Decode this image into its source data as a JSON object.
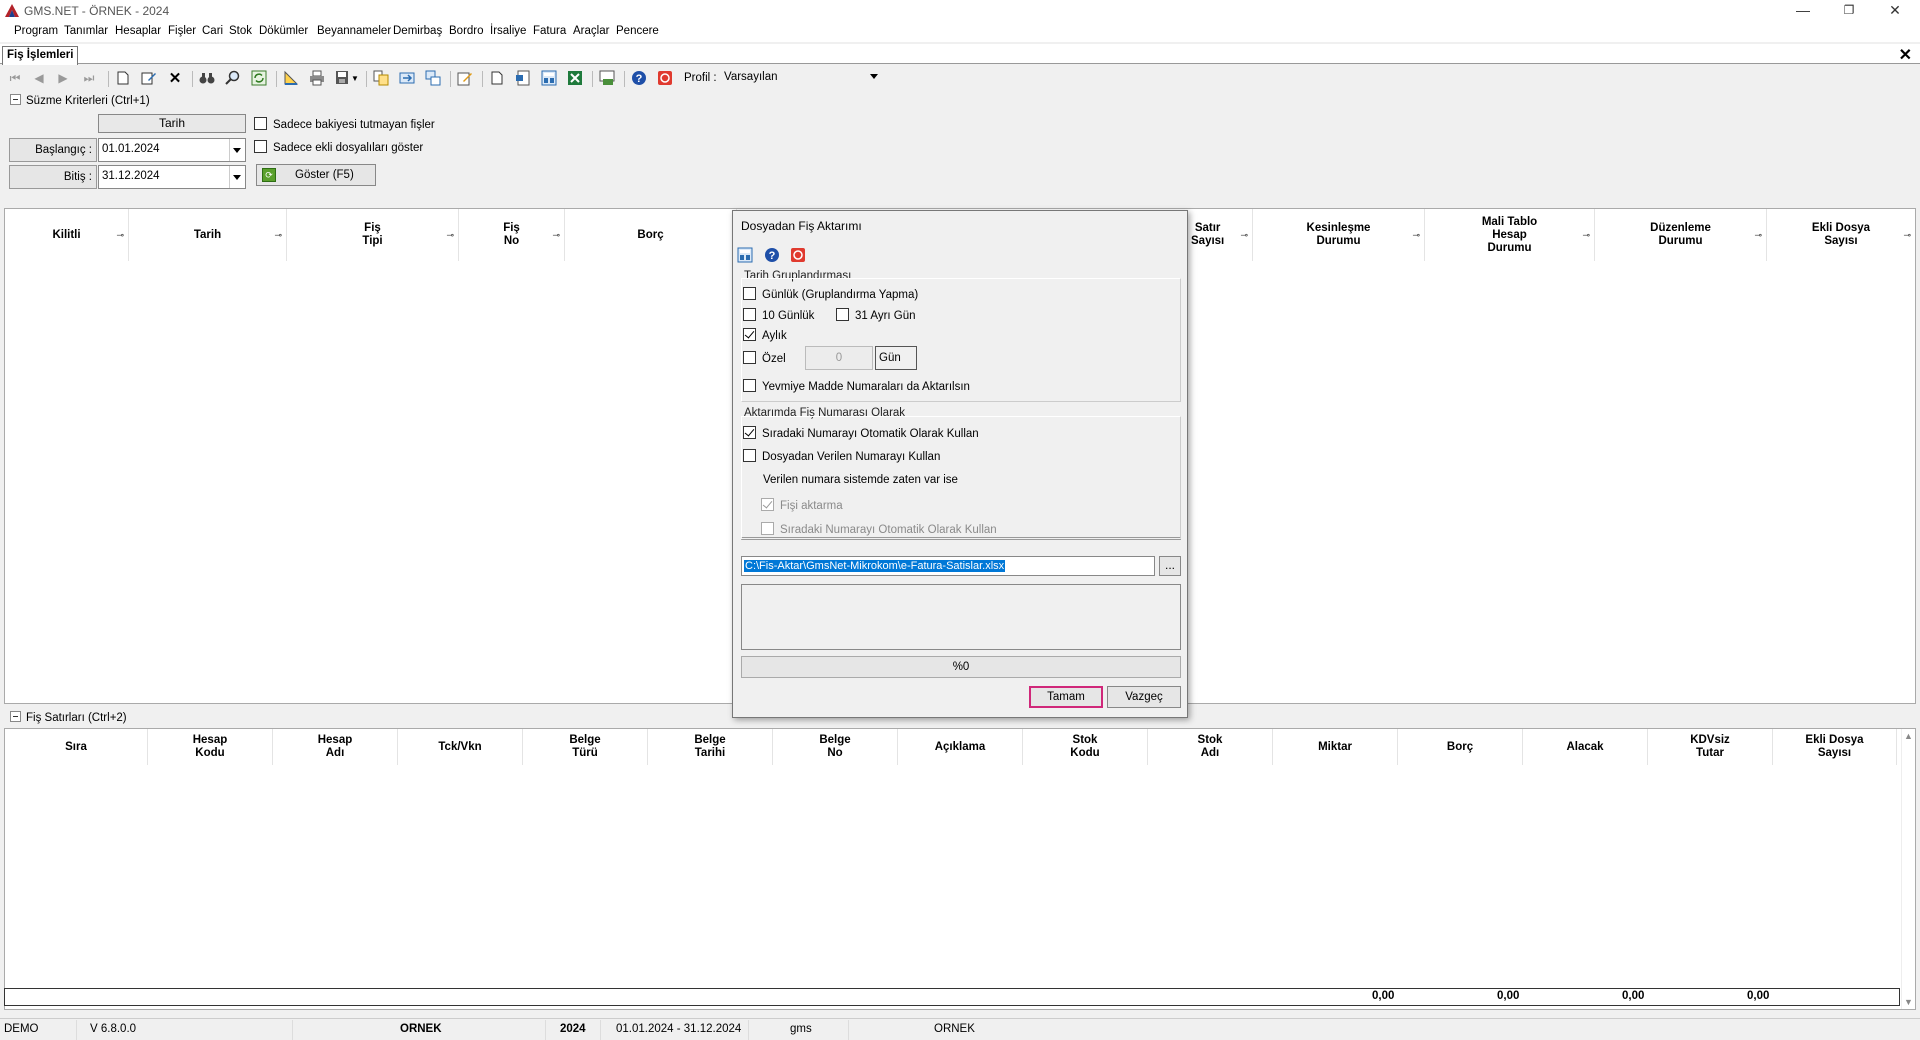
{
  "window": {
    "title": "GMS.NET - ÖRNEK - 2024",
    "minimize": "—",
    "restore": "❐",
    "close": "✕"
  },
  "menu": [
    "Program",
    "Tanımlar",
    "Hesaplar",
    "Fişler",
    "Cari",
    "Stok",
    "Dökümler",
    "Beyannameler",
    "Demirbaş",
    "Bordro",
    "İrsaliye",
    "Fatura",
    "Araçlar",
    "Pencere"
  ],
  "doc_tab": {
    "label": "Fiş İşlemleri",
    "close": "✕"
  },
  "toolbar": {
    "profile_label": "Profil :",
    "profile_value": "Varsayılan"
  },
  "filters": {
    "section_title": "Süzme Kriterleri (Ctrl+1)",
    "tarih_button": "Tarih",
    "start_label": "Başlangıç :",
    "start_value": "01.01.2024",
    "end_label": "Bitiş :",
    "end_value": "31.12.2024",
    "check_unbalanced": "Sadece bakiyesi tutmayan fişler",
    "check_attached": "Sadece ekli dosyalıları göster",
    "show_button": "Göster (F5)"
  },
  "top_grid": {
    "columns": [
      [
        "Kilitli"
      ],
      [
        "Tarih"
      ],
      [
        "Fiş",
        "Tipi"
      ],
      [
        "Fiş",
        "No"
      ],
      [
        "Borç"
      ],
      [
        "Satır",
        "Sayısı"
      ],
      [
        "Kesinleşme",
        "Durumu"
      ],
      [
        "Mali Tablo",
        "Hesap",
        "Durumu"
      ],
      [
        "Düzenleme",
        "Durumu"
      ],
      [
        "Ekli Dosya",
        "Sayısı"
      ]
    ]
  },
  "lines": {
    "section_title": "Fiş Satırları (Ctrl+2)",
    "columns": [
      [
        "Sıra"
      ],
      [
        "Hesap",
        "Kodu"
      ],
      [
        "Hesap",
        "Adı"
      ],
      [
        "Tck/Vkn"
      ],
      [
        "Belge",
        "Türü"
      ],
      [
        "Belge",
        "Tarihi"
      ],
      [
        "Belge",
        "No"
      ],
      [
        "Açıklama"
      ],
      [
        "Stok",
        "Kodu"
      ],
      [
        "Stok",
        "Adı"
      ],
      [
        "Miktar"
      ],
      [
        "Borç"
      ],
      [
        "Alacak"
      ],
      [
        "KDVsiz",
        "Tutar"
      ],
      [
        "Ekli Dosya",
        "Sayısı"
      ]
    ],
    "totals": {
      "miktar": "0,00",
      "borc": "0,00",
      "alacak": "0,00",
      "kdvsiz": "0,00"
    }
  },
  "status": {
    "mode": "DEMO",
    "version": "V 6.8.0.0",
    "company": "ORNEK",
    "year": "2024",
    "period": "01.01.2024 - 31.12.2024",
    "user": "gms",
    "db": "ORNEK"
  },
  "dialog": {
    "title": "Dosyadan Fiş Aktarımı",
    "group1_title": "Tarih Gruplandırması",
    "daily": "Günlük (Gruplandırma Yapma)",
    "daily_checked": false,
    "ten_day": "10 Günlük",
    "ten_day_checked": false,
    "thirty_one": "31 Ayrı Gün",
    "thirty_one_checked": false,
    "monthly": "Aylık",
    "monthly_checked": true,
    "custom": "Özel",
    "custom_checked": false,
    "custom_value": "0",
    "custom_unit": "Gün",
    "journal_numbers": "Yevmiye Madde Numaraları da Aktarılsın",
    "journal_numbers_checked": false,
    "group2_title": "Aktarımda Fiş Numarası Olarak",
    "auto_number": "Sıradaki Numarayı Otomatik Olarak Kullan",
    "auto_number_checked": true,
    "file_number": "Dosyadan Verilen Numarayı Kullan",
    "file_number_checked": false,
    "exists_text": "Verilen numara sistemde zaten var ise",
    "skip_doc": "Fişi aktarma",
    "skip_doc_checked": true,
    "auto_next": "Sıradaki Numarayı Otomatik Olarak Kullan",
    "auto_next_checked": false,
    "file_path": "C:\\Fis-Aktar\\GmsNet-Mikrokom\\e-Fatura-Satislar.xlsx",
    "browse": "...",
    "progress": "%0",
    "ok": "Tamam",
    "cancel": "Vazgeç"
  }
}
